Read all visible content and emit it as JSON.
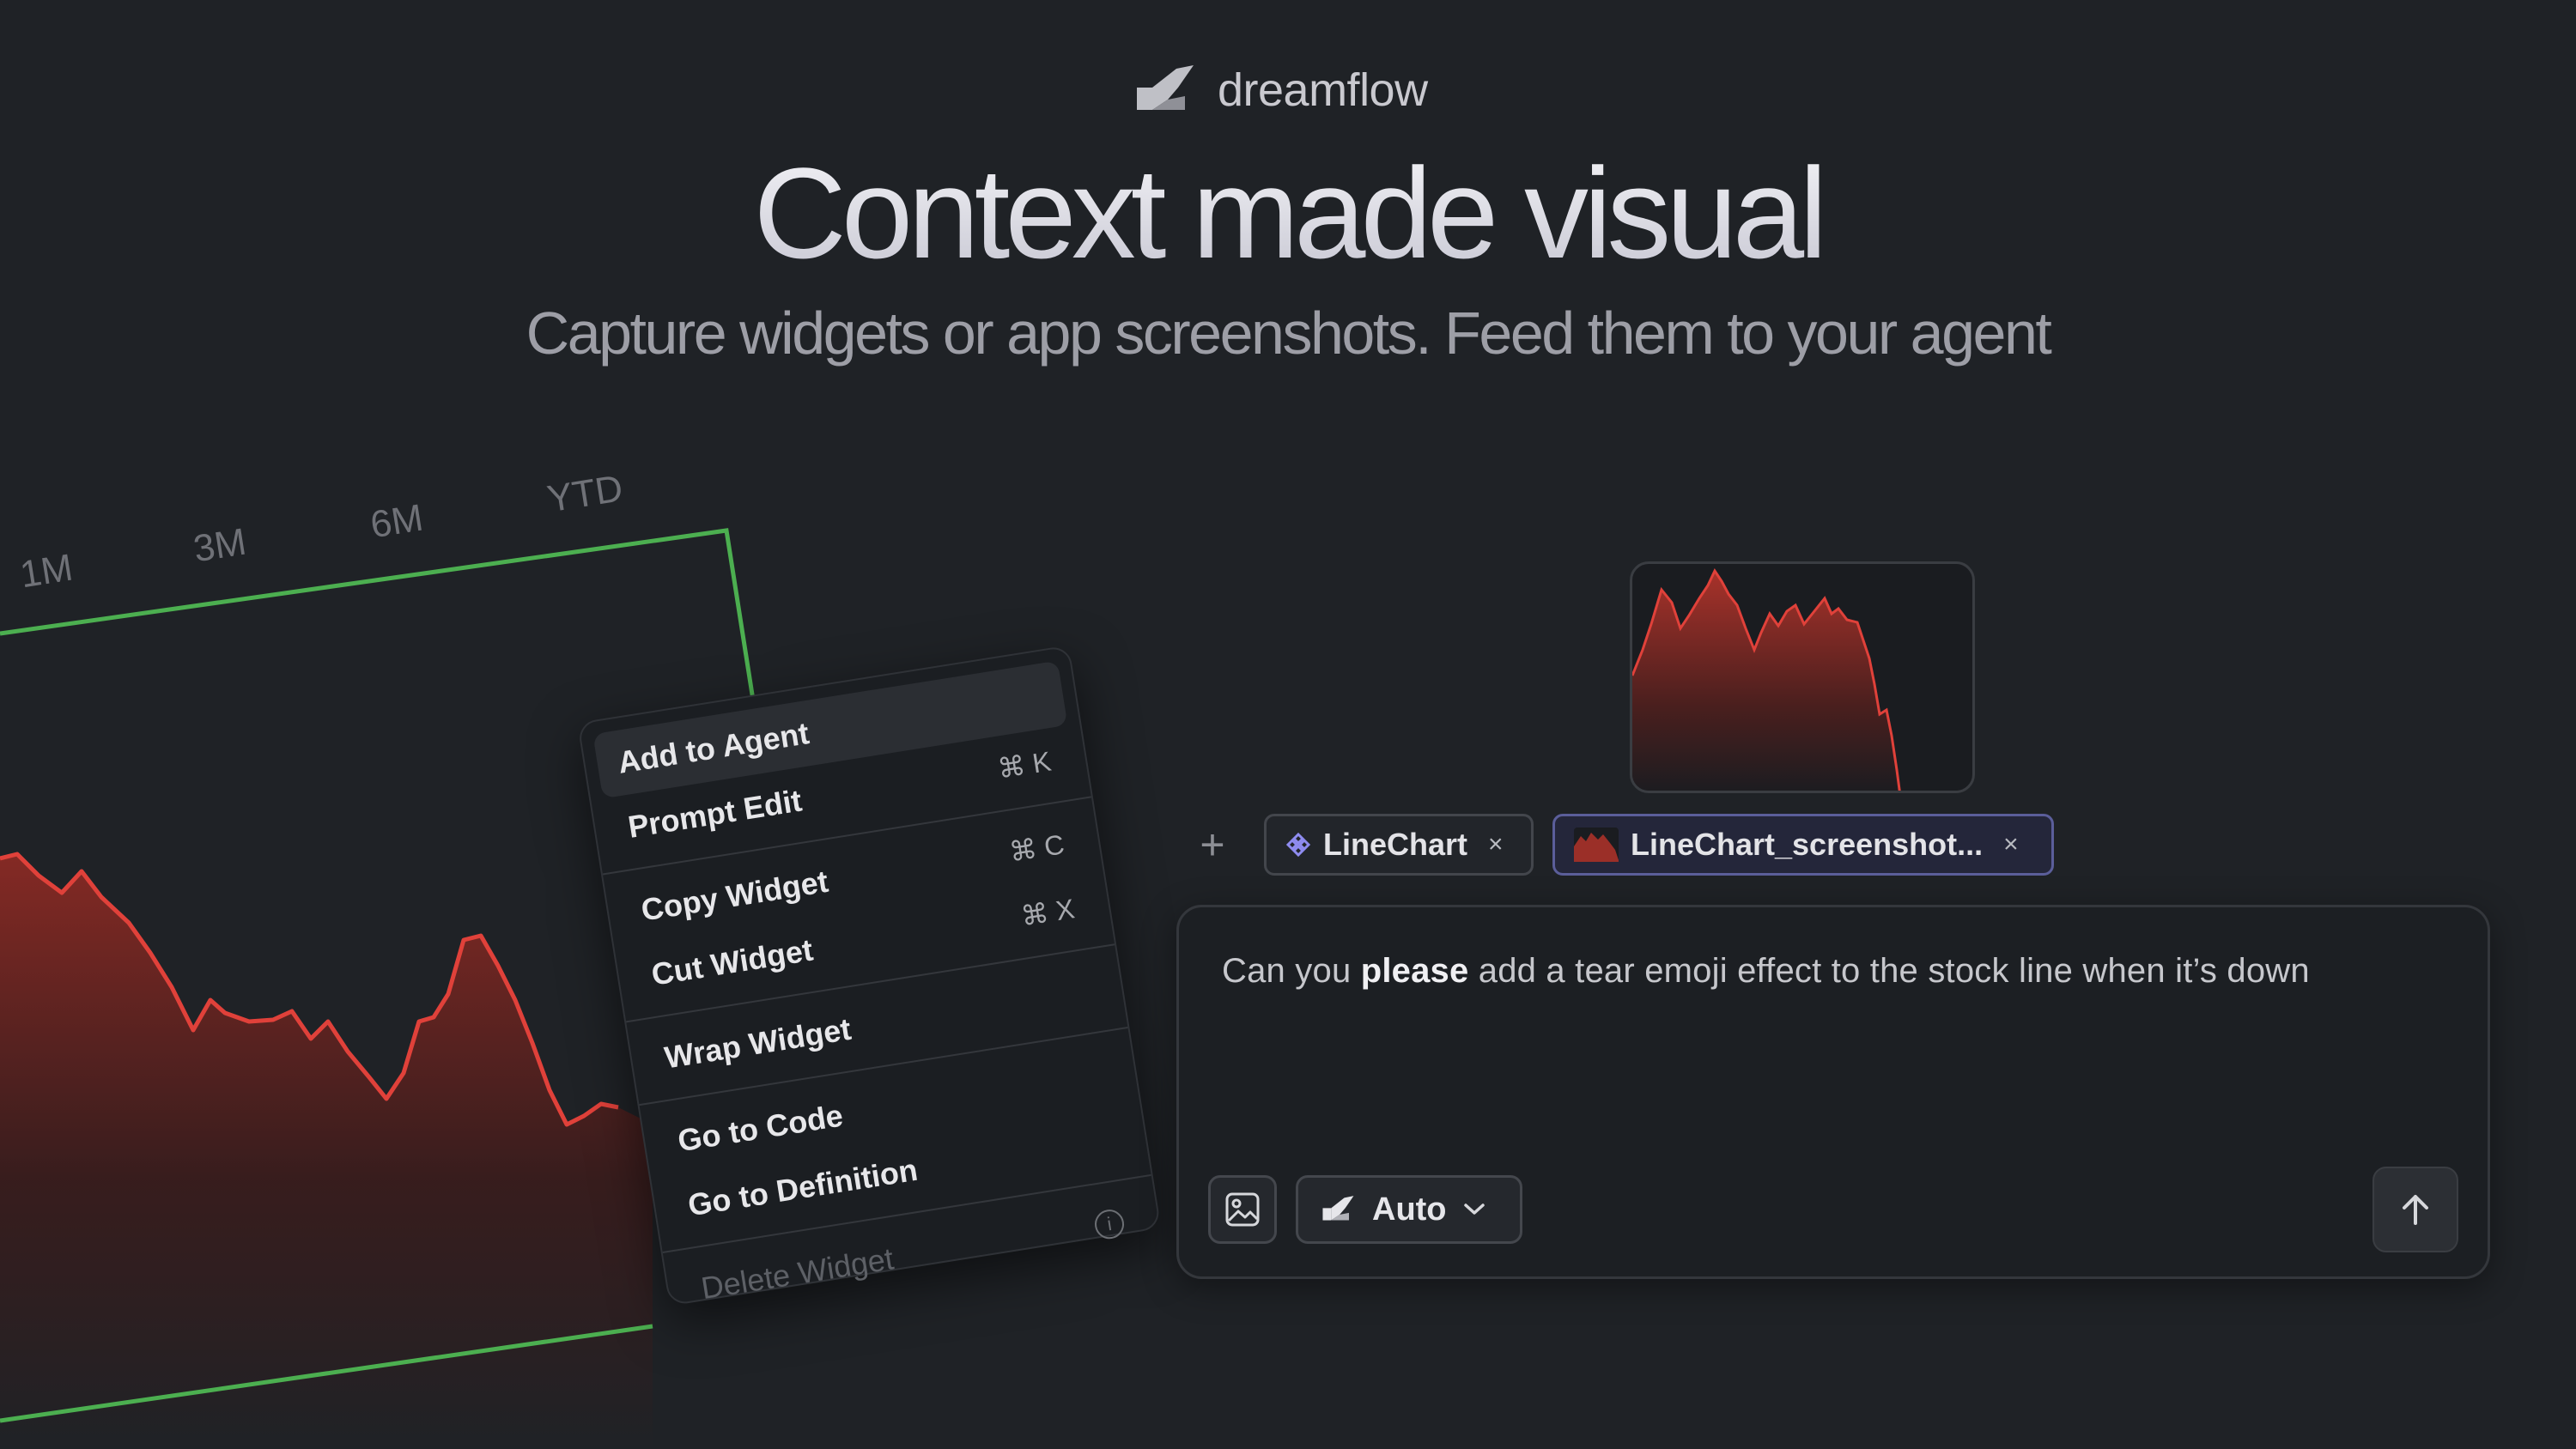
{
  "brand": {
    "name": "dreamflow",
    "logo_icon": "dreamflow-logo-icon"
  },
  "hero": {
    "title": "Context made visual",
    "subtitle": "Capture widgets or app screenshots. Feed them to your agent"
  },
  "chart_panel": {
    "periods": [
      "1M",
      "3M",
      "6M",
      "YTD"
    ],
    "selection_color": "#4caf50",
    "line_color": "#e0413a"
  },
  "context_menu": {
    "items": [
      {
        "label": "Add to Agent",
        "shortcut": "",
        "highlighted": true
      },
      {
        "label": "Prompt Edit",
        "shortcut": "⌘ K"
      },
      {
        "label": "Copy Widget",
        "shortcut": "⌘ C"
      },
      {
        "label": "Cut Widget",
        "shortcut": "⌘ X"
      },
      {
        "label": "Wrap Widget",
        "shortcut": ""
      },
      {
        "label": "Go to Code",
        "shortcut": ""
      },
      {
        "label": "Go to Definition",
        "shortcut": ""
      },
      {
        "label": "Delete Widget",
        "shortcut": "",
        "disabled": true
      }
    ]
  },
  "composer": {
    "add_label": "+",
    "chips": [
      {
        "label": "LineChart",
        "icon": "widget-icon",
        "close": "×"
      },
      {
        "label": "LineChart_screenshot...",
        "icon": "screenshot-thumb-icon",
        "close": "×"
      }
    ],
    "prompt_before": "Can you ",
    "prompt_bold": "please",
    "prompt_after": " add a tear emoji effect to the stock line when it’s down",
    "model_label": "Auto",
    "image_button_icon": "image-icon",
    "send_icon": "arrow-up-icon"
  }
}
